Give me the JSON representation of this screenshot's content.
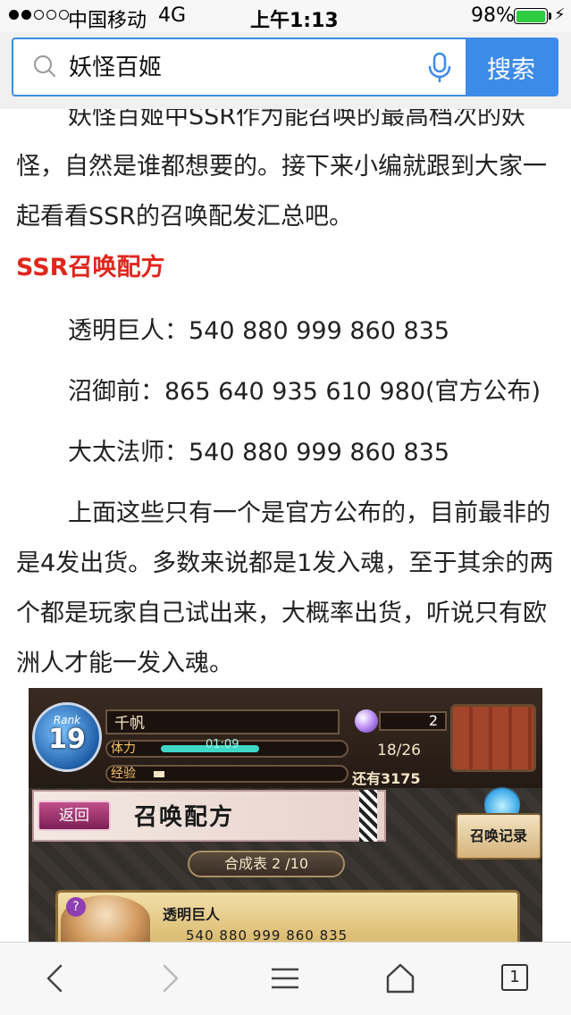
{
  "status_bar": {
    "signal_dots_filled": 2,
    "signal_dots_total": 5,
    "carrier": "中国移动",
    "network": "4G",
    "time": "上午1:13",
    "battery_percent": "98%",
    "battery_level": 0.98,
    "battery_color": "#2ecc40"
  },
  "search": {
    "query": "妖怪百姬",
    "button_label": "搜索",
    "accent_color": "#3d8be8",
    "icon": "search-icon",
    "mic_icon": "microphone-icon"
  },
  "article": {
    "intro": "妖怪百姬中SSR作为能召唤的最高档次的妖怪，自然是谁都想要的。接下来小编就跟到大家一起看看SSR的召唤配发汇总吧。",
    "heading": "SSR召唤配方",
    "heading_color": "#e1261c",
    "formulas": [
      "透明巨人：540 880 999 860 835",
      "沼御前：865 640 935 610 980(官方公布)",
      "大太法师：540 880 999 860 835"
    ],
    "summary": "上面这些只有一个是官方公布的，目前最非的是4发出货。多数来说都是1发入魂，至于其余的两个都是玩家自己试出来，大概率出货，听说只有欧洲人才能一发入魂。"
  },
  "game_image": {
    "rank_label": "Rank",
    "rank_value": "19",
    "player_name": "千帆",
    "hp_label": "体力",
    "hp_timer": "01:09",
    "exp_label": "经验",
    "orb_count": "2",
    "stamina": "18/26",
    "remaining": "还有3175",
    "back_label": "返回",
    "title": "召唤配方",
    "record_label": "召唤记录",
    "table_label": "合成表 2 /10",
    "recipe_icon": "?",
    "recipe_name": "透明巨人",
    "recipe_numbers": "540   880   999   860   835"
  },
  "toolbar": {
    "back_icon": "chevron-left-icon",
    "forward_icon": "chevron-right-icon",
    "menu_icon": "menu-icon",
    "home_icon": "home-icon",
    "tabs_count": "1"
  }
}
